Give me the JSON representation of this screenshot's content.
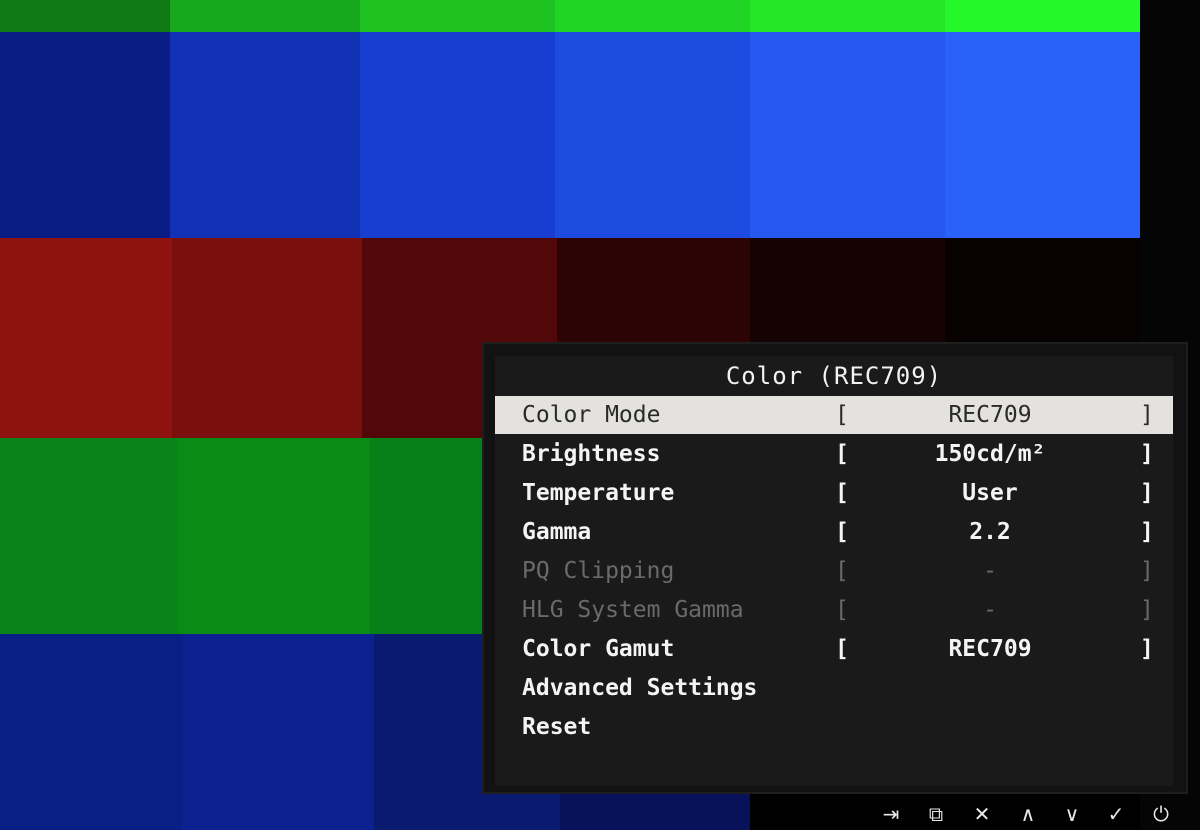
{
  "colors": {
    "green_top": [
      "#0f7a14",
      "#17a81e",
      "#1ec322",
      "#20d424",
      "#22e626",
      "#24f828"
    ],
    "blue_top": [
      "#0a1d86",
      "#1130b4",
      "#173ed0",
      "#1d4be0",
      "#2458ee",
      "#2a62f8"
    ],
    "red": [
      "#8e1210",
      "#7a0f0e",
      "#520808",
      "#2c0404",
      "#150202",
      "#080101"
    ],
    "green_mid": [
      "#0a8418",
      "#098c16",
      "#07801a",
      "#0a7414"
    ],
    "blue_bottom": [
      "#0a1f86",
      "#0c2090",
      "#0a1a70",
      "#08125a"
    ]
  },
  "osd": {
    "title": "Color (REC709)",
    "rows": [
      {
        "label": "Color Mode",
        "value": "REC709",
        "open": "[",
        "close": "]",
        "state": "selected"
      },
      {
        "label": "Brightness",
        "value": "150cd/m²",
        "open": "[",
        "close": "]",
        "state": "normal"
      },
      {
        "label": "Temperature",
        "value": "User",
        "open": "[",
        "close": "]",
        "state": "normal"
      },
      {
        "label": "Gamma",
        "value": "2.2",
        "open": "[",
        "close": "]",
        "state": "normal"
      },
      {
        "label": "PQ Clipping",
        "value": "-",
        "open": "[",
        "close": "]",
        "state": "disabled"
      },
      {
        "label": "HLG System Gamma",
        "value": "-",
        "open": "[",
        "close": "]",
        "state": "disabled"
      },
      {
        "label": "Color Gamut",
        "value": "REC709",
        "open": "[",
        "close": "]",
        "state": "normal"
      },
      {
        "label": "Advanced Settings",
        "value": "",
        "open": "",
        "close": "",
        "state": "normal"
      },
      {
        "label": "Reset",
        "value": "",
        "open": "",
        "close": "",
        "state": "normal"
      }
    ]
  },
  "buttons": [
    {
      "icon": "input-icon",
      "glyph": "⇥"
    },
    {
      "icon": "mode-icon",
      "glyph": "⧉"
    },
    {
      "icon": "close-icon",
      "glyph": "✕"
    },
    {
      "icon": "up-icon",
      "glyph": "∧"
    },
    {
      "icon": "down-icon",
      "glyph": "∨"
    },
    {
      "icon": "check-icon",
      "glyph": "✓"
    },
    {
      "icon": "power-icon",
      "glyph": "⏻"
    }
  ]
}
